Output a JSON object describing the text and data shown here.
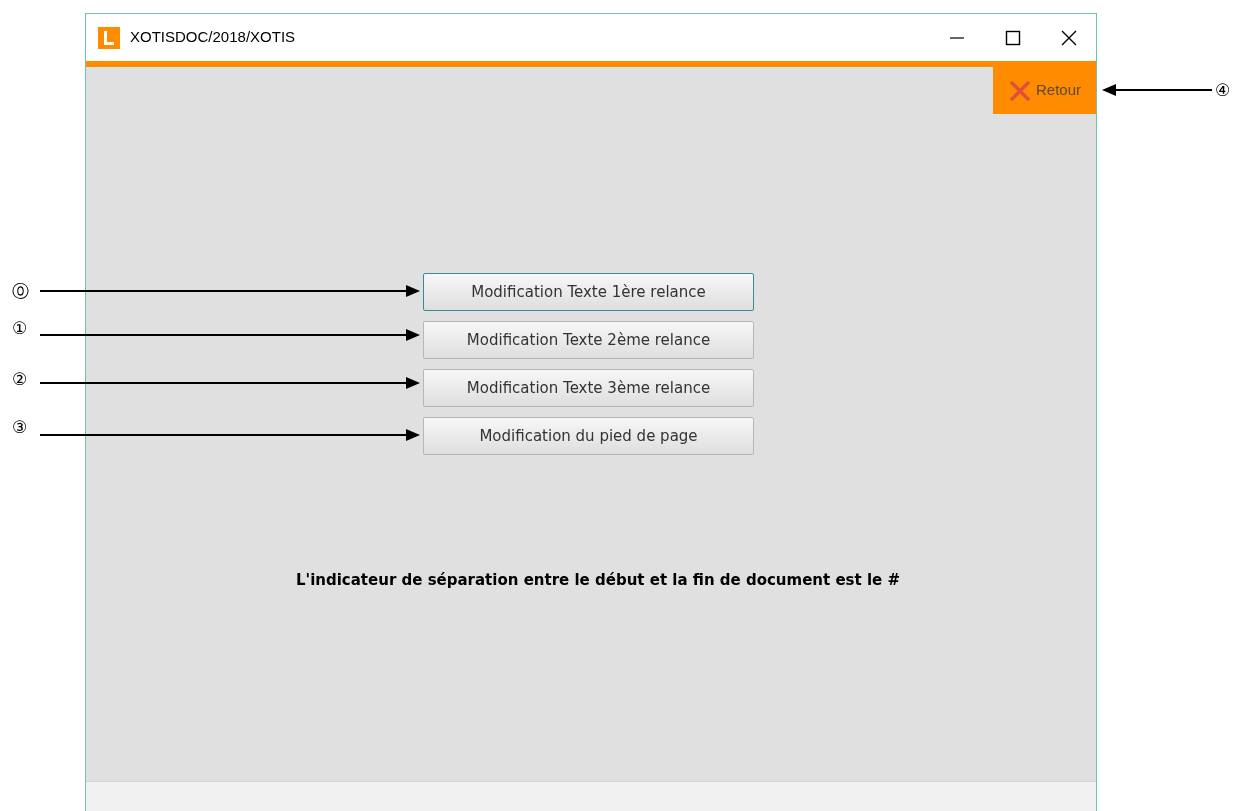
{
  "window": {
    "title": "XOTISDOC/2018/XOTIS"
  },
  "back_button": {
    "label": "Retour"
  },
  "buttons": [
    {
      "label": "Modification Texte 1ère relance",
      "selected": true
    },
    {
      "label": "Modification Texte 2ème relance",
      "selected": false
    },
    {
      "label": "Modification Texte 3ème relance",
      "selected": false
    },
    {
      "label": "Modification du pied de page",
      "selected": false
    }
  ],
  "note": "L'indicateur de séparation entre le début et la fin de document est le #",
  "callouts": [
    {
      "label": "⓪"
    },
    {
      "label": "①"
    },
    {
      "label": "②"
    },
    {
      "label": "③"
    },
    {
      "label": "④"
    }
  ]
}
